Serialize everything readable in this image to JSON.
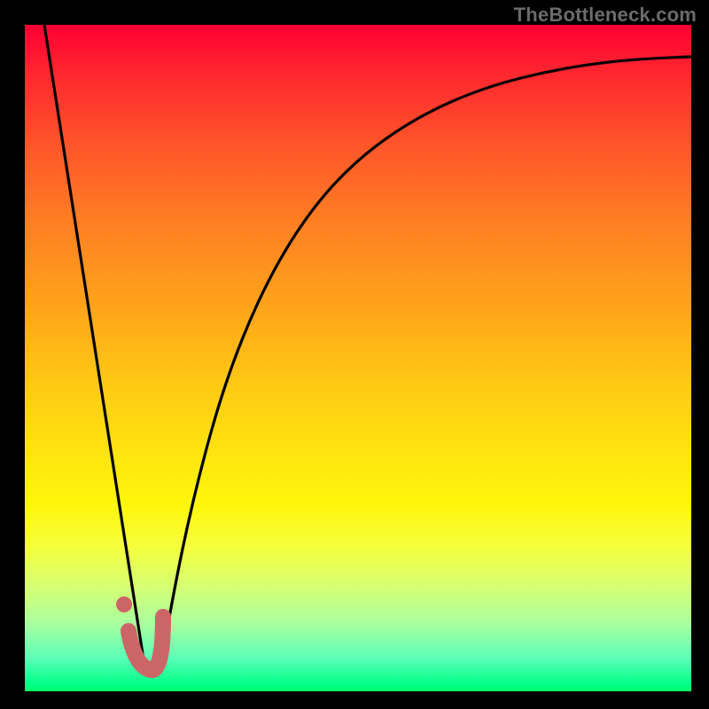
{
  "watermark": "TheBottleneck.com",
  "chart_data": {
    "type": "line",
    "title": "",
    "xlabel": "",
    "ylabel": "",
    "xlim": [
      0,
      100
    ],
    "ylim": [
      0,
      100
    ],
    "grid": false,
    "legend": false,
    "series": [
      {
        "name": "falling-line",
        "x": [
          3,
          18
        ],
        "values": [
          100,
          3
        ],
        "style": "straight"
      },
      {
        "name": "rising-curve",
        "x": [
          20,
          25,
          30,
          35,
          40,
          50,
          60,
          70,
          80,
          90,
          100
        ],
        "values": [
          3,
          24,
          42,
          55,
          64,
          76,
          83,
          87,
          90,
          92,
          93
        ],
        "style": "smooth"
      }
    ],
    "marker": {
      "name": "j-marker",
      "color": "#cc6666",
      "points": [
        {
          "x": 15.5,
          "y": 9
        },
        {
          "x": 17.5,
          "y": 4
        },
        {
          "x": 20.5,
          "y": 3
        },
        {
          "x": 20.5,
          "y": 11
        }
      ],
      "dot": {
        "x": 14.8,
        "y": 13
      }
    }
  }
}
